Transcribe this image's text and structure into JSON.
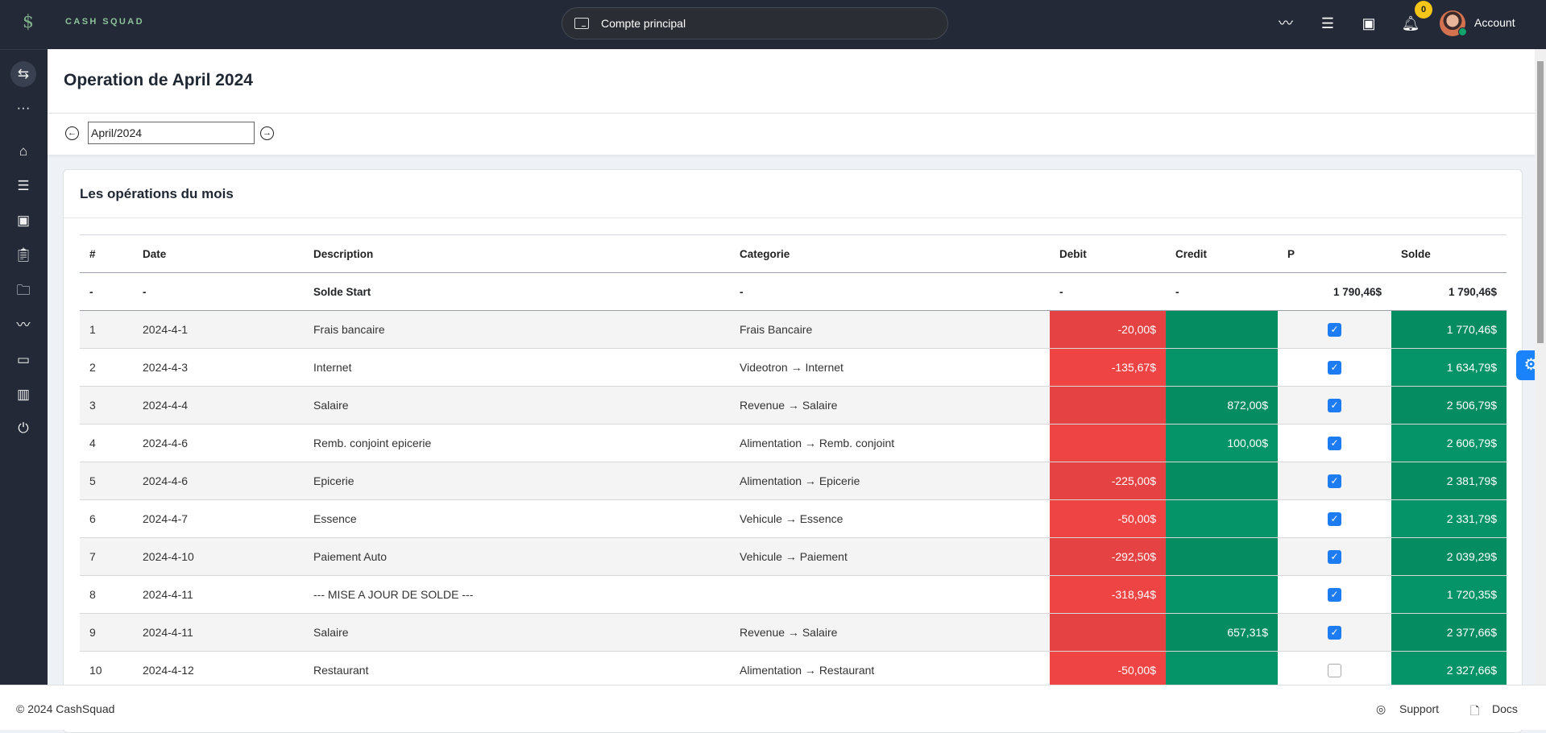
{
  "header": {
    "brand": "CASH SQUAD",
    "account_selector": "Compte principal",
    "notification_count": "0",
    "account_label": "Account"
  },
  "page": {
    "title": "Operation de April 2024",
    "month_value": "April/2024"
  },
  "card": {
    "title": "Les opérations du mois"
  },
  "table": {
    "columns": [
      "#",
      "Date",
      "Description",
      "Categorie",
      "Debit",
      "Credit",
      "P",
      "Solde"
    ],
    "start_row": {
      "num": "-",
      "date": "-",
      "description": "Solde Start",
      "category": "-",
      "debit": "-",
      "credit": "-",
      "p": "1 790,46$",
      "solde": "1 790,46$"
    },
    "rows": [
      {
        "num": "1",
        "date": "2024-4-1",
        "description": "Frais bancaire",
        "category": "Frais Bancaire",
        "debit": "-20,00$",
        "credit": "",
        "checked": true,
        "solde": "1 770,46$"
      },
      {
        "num": "2",
        "date": "2024-4-3",
        "description": "Internet",
        "category": "Videotron → Internet",
        "debit": "-135,67$",
        "credit": "",
        "checked": true,
        "solde": "1 634,79$"
      },
      {
        "num": "3",
        "date": "2024-4-4",
        "description": "Salaire",
        "category": "Revenue → Salaire",
        "debit": "",
        "credit": "872,00$",
        "checked": true,
        "solde": "2 506,79$"
      },
      {
        "num": "4",
        "date": "2024-4-6",
        "description": "Remb. conjoint epicerie",
        "category": "Alimentation → Remb. conjoint",
        "debit": "",
        "credit": "100,00$",
        "checked": true,
        "solde": "2 606,79$"
      },
      {
        "num": "5",
        "date": "2024-4-6",
        "description": "Epicerie",
        "category": "Alimentation → Epicerie",
        "debit": "-225,00$",
        "credit": "",
        "checked": true,
        "solde": "2 381,79$"
      },
      {
        "num": "6",
        "date": "2024-4-7",
        "description": "Essence",
        "category": "Vehicule → Essence",
        "debit": "-50,00$",
        "credit": "",
        "checked": true,
        "solde": "2 331,79$"
      },
      {
        "num": "7",
        "date": "2024-4-10",
        "description": "Paiement Auto",
        "category": "Vehicule → Paiement",
        "debit": "-292,50$",
        "credit": "",
        "checked": true,
        "solde": "2 039,29$"
      },
      {
        "num": "8",
        "date": "2024-4-11",
        "description": "--- MISE A JOUR DE SOLDE ---",
        "category": "",
        "debit": "-318,94$",
        "credit": "",
        "checked": true,
        "solde": "1 720,35$"
      },
      {
        "num": "9",
        "date": "2024-4-11",
        "description": "Salaire",
        "category": "Revenue → Salaire",
        "debit": "",
        "credit": "657,31$",
        "checked": true,
        "solde": "2 377,66$"
      },
      {
        "num": "10",
        "date": "2024-4-12",
        "description": "Restaurant",
        "category": "Alimentation → Restaurant",
        "debit": "-50,00$",
        "credit": "",
        "checked": false,
        "solde": "2 327,66$"
      }
    ]
  },
  "footer": {
    "copyright": "© 2024 CashSquad",
    "support": "Support",
    "docs": "Docs"
  },
  "colors": {
    "debit": "#ef4444",
    "credit": "#059467",
    "accent": "#1a82fb",
    "topbar": "#232936"
  }
}
